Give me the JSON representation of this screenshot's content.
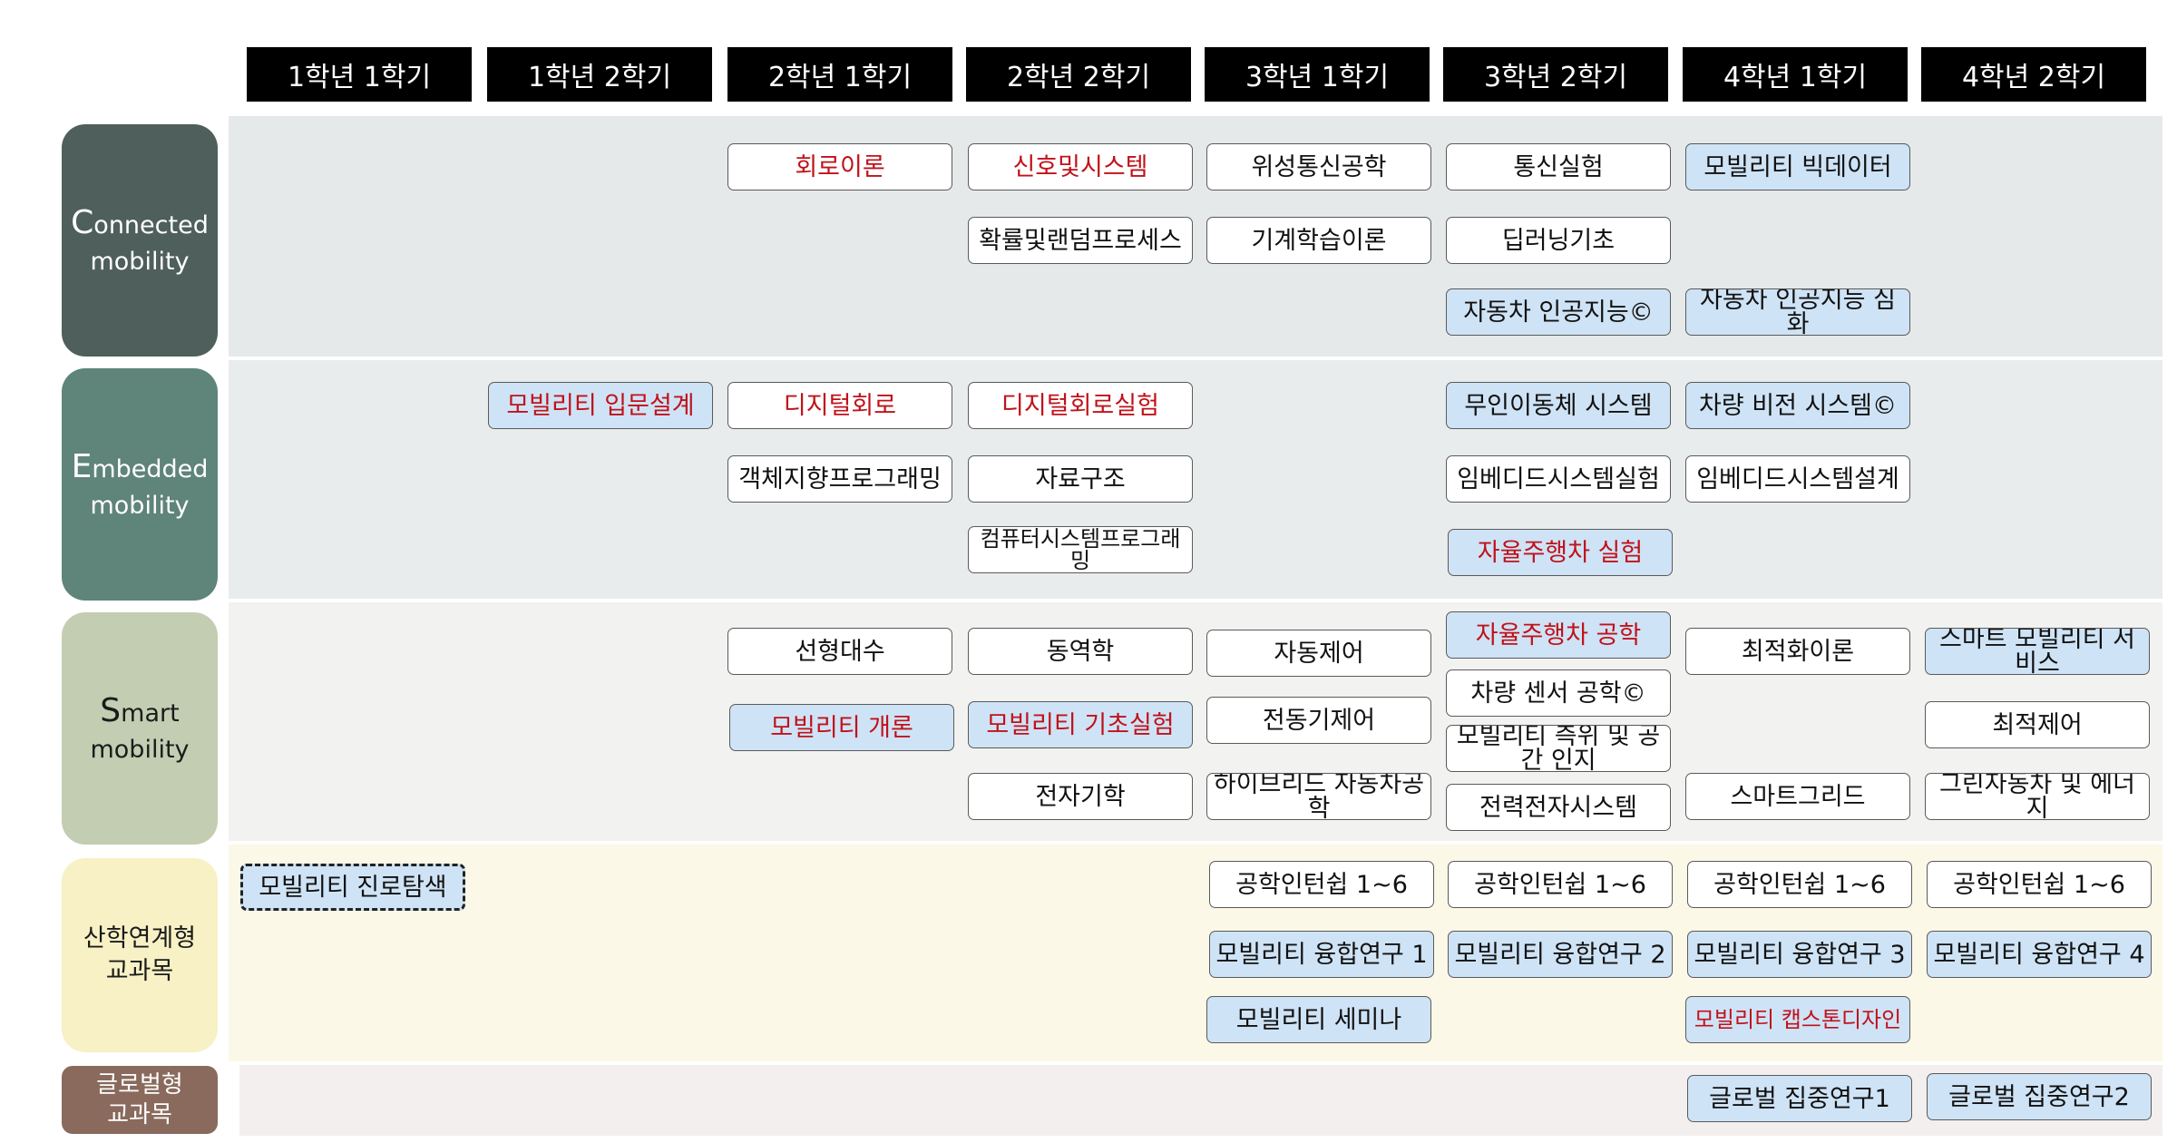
{
  "semesters": [
    "1학년 1학기",
    "1학년 2학기",
    "2학년 1학기",
    "2학년 2학기",
    "3학년 1학기",
    "3학년 2학기",
    "4학년 1학기",
    "4학년 2학기"
  ],
  "categories": {
    "connected": {
      "initial": "C",
      "rest": "onnected",
      "line2": "mobility"
    },
    "embedded": {
      "initial": "E",
      "rest": "mbedded",
      "line2": "mobility"
    },
    "smart": {
      "initial": "S",
      "rest": "mart",
      "line2": "mobility"
    },
    "industry": {
      "line1": "산학연계형",
      "line2": "교과목"
    },
    "global": {
      "line1": "글로벌형",
      "line2": "교과목"
    }
  },
  "courses": [
    {
      "label": "회로이론",
      "style": "red"
    },
    {
      "label": "신호및시스템",
      "style": "red"
    },
    {
      "label": "위성통신공학",
      "style": "plain"
    },
    {
      "label": "통신실험",
      "style": "plain"
    },
    {
      "label": "모빌리티 빅데이터",
      "style": "blue"
    },
    {
      "label": "확률및랜덤프로세스",
      "style": "plain"
    },
    {
      "label": "기계학습이론",
      "style": "plain"
    },
    {
      "label": "딥러닝기초",
      "style": "plain"
    },
    {
      "label": "자동차 인공지능©",
      "style": "blue"
    },
    {
      "label": "자동차 인공지능 심화",
      "style": "blue"
    },
    {
      "label": "모빌리티 입문설계",
      "style": "blue-red"
    },
    {
      "label": "디지털회로",
      "style": "red"
    },
    {
      "label": "디지털회로실험",
      "style": "red"
    },
    {
      "label": "무인이동체 시스템",
      "style": "blue"
    },
    {
      "label": "차량 비전 시스템©",
      "style": "blue"
    },
    {
      "label": "객체지향프로그래밍",
      "style": "plain"
    },
    {
      "label": "자료구조",
      "style": "plain"
    },
    {
      "label": "임베디드시스템실험",
      "style": "plain"
    },
    {
      "label": "임베디드시스템설계",
      "style": "plain"
    },
    {
      "label": "컴퓨터시스템프로그래밍",
      "style": "plain"
    },
    {
      "label": "자율주행차 실험",
      "style": "blue-red"
    },
    {
      "label": "선형대수",
      "style": "plain"
    },
    {
      "label": "동역학",
      "style": "plain"
    },
    {
      "label": "자동제어",
      "style": "plain"
    },
    {
      "label": "자율주행차 공학",
      "style": "blue-red"
    },
    {
      "label": "최적화이론",
      "style": "plain"
    },
    {
      "label": "스마트 모빌리티 서비스",
      "style": "blue"
    },
    {
      "label": "차량 센서 공학©",
      "style": "plain"
    },
    {
      "label": "모빌리티 개론",
      "style": "blue-red"
    },
    {
      "label": "모빌리티 기초실험",
      "style": "blue-red"
    },
    {
      "label": "전동기제어",
      "style": "plain"
    },
    {
      "label": "모빌리티 측위 및 공간 인지",
      "style": "plain"
    },
    {
      "label": "최적제어",
      "style": "plain"
    },
    {
      "label": "전자기학",
      "style": "plain"
    },
    {
      "label": "하이브리드 자동차공학",
      "style": "plain"
    },
    {
      "label": "전력전자시스템",
      "style": "plain"
    },
    {
      "label": "스마트그리드",
      "style": "plain"
    },
    {
      "label": "그린자동차 및 에너지",
      "style": "plain"
    },
    {
      "label": "모빌리티 진로탐색",
      "style": "blue-dashed"
    },
    {
      "label": "공학인턴쉽 1~6",
      "style": "plain"
    },
    {
      "label": "공학인턴쉽 1~6",
      "style": "plain"
    },
    {
      "label": "공학인턴쉽 1~6",
      "style": "plain"
    },
    {
      "label": "공학인턴쉽 1~6",
      "style": "plain"
    },
    {
      "label": "모빌리티 융합연구 1",
      "style": "blue"
    },
    {
      "label": "모빌리티 융합연구 2",
      "style": "blue"
    },
    {
      "label": "모빌리티 융합연구 3",
      "style": "blue"
    },
    {
      "label": "모빌리티 융합연구 4",
      "style": "blue"
    },
    {
      "label": "모빌리티 세미나",
      "style": "blue"
    },
    {
      "label": "모빌리티 캡스톤디자인",
      "style": "blue-red"
    },
    {
      "label": "글로벌 집중연구1",
      "style": "blue"
    },
    {
      "label": "글로벌 집중연구2",
      "style": "blue"
    }
  ]
}
